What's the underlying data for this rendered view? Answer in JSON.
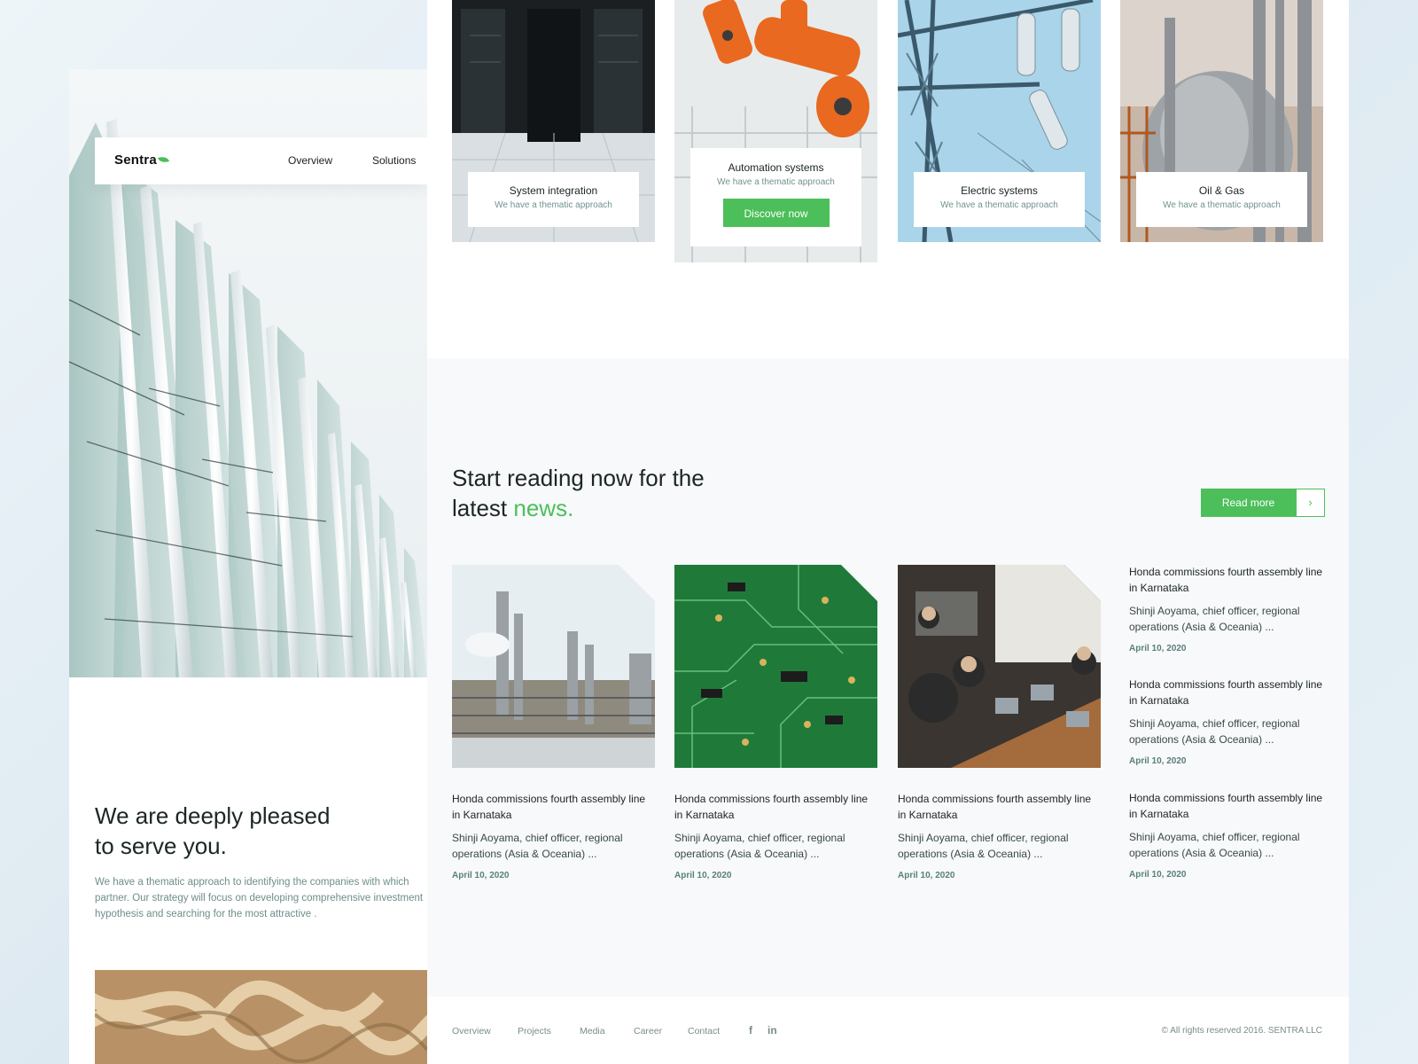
{
  "brand": {
    "name": "Sentra",
    "accent": "#4cbf5a"
  },
  "nav": {
    "overview": "Overview",
    "solutions": "Solutions"
  },
  "intro": {
    "title_line1": "We are deeply pleased",
    "title_line2": "to serve you.",
    "text": "We have a thematic approach to identifying the companies with which partner. Our strategy will focus on developing comprehensive investment hypothesis and searching for the most attractive ."
  },
  "solutions": [
    {
      "title": "System integration",
      "subtitle": "We have a thematic approach"
    },
    {
      "title": "Automation systems",
      "subtitle": "We have a thematic approach",
      "button": "Discover now"
    },
    {
      "title": "Electric systems",
      "subtitle": "We have a thematic approach"
    },
    {
      "title": "Oil & Gas",
      "subtitle": "We have a thematic approach"
    }
  ],
  "news": {
    "title_part1": "Start reading now for the latest",
    "title_highlight": "news.",
    "read_more": "Read more",
    "items": [
      {
        "headline": "Honda commissions fourth assembly line in Karnataka",
        "description": "Shinji Aoyama, chief officer, regional operations (Asia & Oceania) ...",
        "date": "April 10, 2020"
      },
      {
        "headline": "Honda commissions fourth assembly line in Karnataka",
        "description": "Shinji Aoyama, chief officer, regional operations (Asia & Oceania) ...",
        "date": "April 10, 2020"
      },
      {
        "headline": "Honda commissions fourth assembly line in Karnataka",
        "description": "Shinji Aoyama, chief officer, regional operations (Asia & Oceania) ...",
        "date": "April 10, 2020"
      }
    ],
    "side_items": [
      {
        "headline": "Honda commissions fourth assembly line in Karnataka",
        "description": "Shinji Aoyama, chief officer, regional operations (Asia & Oceania) ...",
        "date": "April 10, 2020"
      },
      {
        "headline": "Honda commissions fourth assembly line in Karnataka",
        "description": "Shinji Aoyama, chief officer, regional operations (Asia & Oceania) ...",
        "date": "April 10, 2020"
      },
      {
        "headline": "Honda commissions fourth assembly line in Karnataka",
        "description": "Shinji Aoyama, chief officer, regional operations (Asia & Oceania) ...",
        "date": "April 10, 2020"
      }
    ]
  },
  "footer": {
    "links": [
      "Overview",
      "Projects",
      "Media",
      "Career",
      "Contact"
    ],
    "facebook": "f",
    "linkedin": "in",
    "copyright": "© All rights reserved 2016. SENTRA LLC"
  }
}
